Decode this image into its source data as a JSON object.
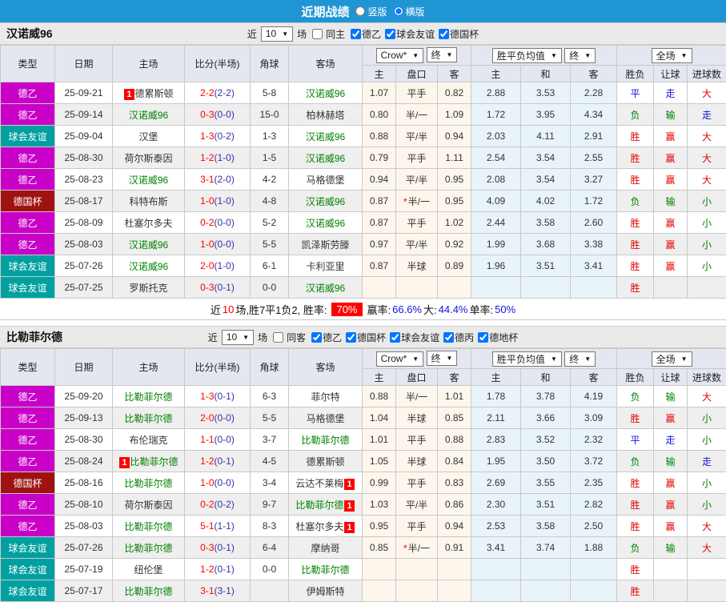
{
  "colors": {
    "accent_blue": "#2095d3",
    "league_de2": "#c800c8",
    "league_cup": "#a01212",
    "league_friendly": "#00a0a0",
    "self_team_green": "#008000",
    "fulltime_score_red": "#ff0000",
    "halftime_score_navy": "#3434a6",
    "win_red": "#e60000",
    "lose_green": "#008000",
    "draw_blue": "#1414dc",
    "rate_badge_bg": "#ff0000"
  },
  "titlebar": {
    "title": "近期战绩",
    "radios": [
      {
        "label": "竖版",
        "checked": false
      },
      {
        "label": "横版",
        "checked": true
      }
    ]
  },
  "header": {
    "cols": [
      "类型",
      "日期",
      "主场",
      "比分(半场)",
      "角球",
      "客场"
    ],
    "dropdowns": {
      "odds": "Crow*",
      "end1": "终",
      "avg": "胜平负均值",
      "end2": "终",
      "full": "全场"
    },
    "subcols": [
      "主",
      "盘口",
      "客",
      "主",
      "和",
      "客",
      "胜负",
      "让球",
      "进球数"
    ]
  },
  "sections": [
    {
      "team": "汉诺威96",
      "near_label": "近",
      "count": "10",
      "unit_label": "场",
      "same_filter": {
        "label": "同主",
        "checked": false
      },
      "filters": [
        {
          "label": "德乙",
          "checked": true
        },
        {
          "label": "球会友谊",
          "checked": true
        },
        {
          "label": "德国杯",
          "checked": true
        }
      ],
      "rows": [
        {
          "lg": "德乙",
          "lgc": "de2",
          "date": "25-09-21",
          "h": "德累斯顿",
          "hs": false,
          "hb": "pre",
          "ft": "2-2",
          "ht": "(2-2)",
          "cn": "5-8",
          "a": "汉诺威96",
          "as": true,
          "ab": null,
          "o1": "1.07",
          "o2": "平手",
          "star": false,
          "o3": "0.82",
          "a1": "2.88",
          "a2": "3.53",
          "a3": "2.28",
          "r1": "平",
          "c1": "b",
          "r2": "走",
          "c2": "b",
          "r3": "大",
          "c3": "r"
        },
        {
          "lg": "德乙",
          "lgc": "de2",
          "date": "25-09-14",
          "h": "汉诺威96",
          "hs": true,
          "hb": null,
          "ft": "0-3",
          "ht": "(0-0)",
          "cn": "15-0",
          "a": "柏林赫塔",
          "as": false,
          "ab": null,
          "o1": "0.80",
          "o2": "半/一",
          "star": false,
          "o3": "1.09",
          "a1": "1.72",
          "a2": "3.95",
          "a3": "4.34",
          "r1": "负",
          "c1": "g",
          "r2": "输",
          "c2": "g",
          "r3": "走",
          "c3": "b"
        },
        {
          "lg": "球会友谊",
          "lgc": "frd",
          "date": "25-09-04",
          "h": "汉堡",
          "hs": false,
          "hb": null,
          "ft": "1-3",
          "ht": "(0-2)",
          "cn": "1-3",
          "a": "汉诺威96",
          "as": true,
          "ab": null,
          "o1": "0.88",
          "o2": "平/半",
          "star": false,
          "o3": "0.94",
          "a1": "2.03",
          "a2": "4.11",
          "a3": "2.91",
          "r1": "胜",
          "c1": "r",
          "r2": "赢",
          "c2": "r",
          "r3": "大",
          "c3": "r"
        },
        {
          "lg": "德乙",
          "lgc": "de2",
          "date": "25-08-30",
          "h": "荷尔斯泰因",
          "hs": false,
          "hb": null,
          "ft": "1-2",
          "ht": "(1-0)",
          "cn": "1-5",
          "a": "汉诺威96",
          "as": true,
          "ab": null,
          "o1": "0.79",
          "o2": "平手",
          "star": false,
          "o3": "1.11",
          "a1": "2.54",
          "a2": "3.54",
          "a3": "2.55",
          "r1": "胜",
          "c1": "r",
          "r2": "赢",
          "c2": "r",
          "r3": "大",
          "c3": "r"
        },
        {
          "lg": "德乙",
          "lgc": "de2",
          "date": "25-08-23",
          "h": "汉诺威96",
          "hs": true,
          "hb": null,
          "ft": "3-1",
          "ht": "(2-0)",
          "cn": "4-2",
          "a": "马格德堡",
          "as": false,
          "ab": null,
          "o1": "0.94",
          "o2": "平/半",
          "star": false,
          "o3": "0.95",
          "a1": "2.08",
          "a2": "3.54",
          "a3": "3.27",
          "r1": "胜",
          "c1": "r",
          "r2": "赢",
          "c2": "r",
          "r3": "大",
          "c3": "r"
        },
        {
          "lg": "德国杯",
          "lgc": "cup",
          "date": "25-08-17",
          "h": "科特布斯",
          "hs": false,
          "hb": null,
          "ft": "1-0",
          "ht": "(1-0)",
          "cn": "4-8",
          "a": "汉诺威96",
          "as": true,
          "ab": null,
          "o1": "0.87",
          "o2": "半/一",
          "star": true,
          "o3": "0.95",
          "a1": "4.09",
          "a2": "4.02",
          "a3": "1.72",
          "r1": "负",
          "c1": "g",
          "r2": "输",
          "c2": "g",
          "r3": "小",
          "c3": "g"
        },
        {
          "lg": "德乙",
          "lgc": "de2",
          "date": "25-08-09",
          "h": "杜塞尔多夫",
          "hs": false,
          "hb": null,
          "ft": "0-2",
          "ht": "(0-0)",
          "cn": "5-2",
          "a": "汉诺威96",
          "as": true,
          "ab": null,
          "o1": "0.87",
          "o2": "平手",
          "star": false,
          "o3": "1.02",
          "a1": "2.44",
          "a2": "3.58",
          "a3": "2.60",
          "r1": "胜",
          "c1": "r",
          "r2": "赢",
          "c2": "r",
          "r3": "小",
          "c3": "g"
        },
        {
          "lg": "德乙",
          "lgc": "de2",
          "date": "25-08-03",
          "h": "汉诺威96",
          "hs": true,
          "hb": null,
          "ft": "1-0",
          "ht": "(0-0)",
          "cn": "5-5",
          "a": "凯泽斯劳滕",
          "as": false,
          "ab": null,
          "o1": "0.97",
          "o2": "平/半",
          "star": false,
          "o3": "0.92",
          "a1": "1.99",
          "a2": "3.68",
          "a3": "3.38",
          "r1": "胜",
          "c1": "r",
          "r2": "赢",
          "c2": "r",
          "r3": "小",
          "c3": "g"
        },
        {
          "lg": "球会友谊",
          "lgc": "frd",
          "date": "25-07-26",
          "h": "汉诺威96",
          "hs": true,
          "hb": null,
          "ft": "2-0",
          "ht": "(1-0)",
          "cn": "6-1",
          "a": "卡利亚里",
          "as": false,
          "ab": null,
          "o1": "0.87",
          "o2": "半球",
          "star": false,
          "o3": "0.89",
          "a1": "1.96",
          "a2": "3.51",
          "a3": "3.41",
          "r1": "胜",
          "c1": "r",
          "r2": "赢",
          "c2": "r",
          "r3": "小",
          "c3": "g"
        },
        {
          "lg": "球会友谊",
          "lgc": "frd",
          "date": "25-07-25",
          "h": "罗斯托克",
          "hs": false,
          "hb": null,
          "ft": "0-3",
          "ht": "(0-1)",
          "cn": "0-0",
          "a": "汉诺威96",
          "as": true,
          "ab": null,
          "o1": "",
          "o2": "",
          "star": false,
          "o3": "",
          "a1": "",
          "a2": "",
          "a3": "",
          "r1": "胜",
          "c1": "r",
          "r2": "",
          "c2": "",
          "r3": "",
          "c3": ""
        }
      ],
      "summary": {
        "prefix": "近",
        "count": "10",
        "mid": "场,胜7平1负2, 胜率:",
        "rate": "70%",
        "win_label": "赢率:",
        "win": "66.6%",
        "big_label": "大:",
        "big": "44.4%",
        "single_label": "单率:",
        "single": "50%"
      }
    },
    {
      "team": "比勒菲尔德",
      "near_label": "近",
      "count": "10",
      "unit_label": "场",
      "same_filter": {
        "label": "同客",
        "checked": false
      },
      "filters": [
        {
          "label": "德乙",
          "checked": true
        },
        {
          "label": "德国杯",
          "checked": true
        },
        {
          "label": "球会友谊",
          "checked": true
        },
        {
          "label": "德丙",
          "checked": true
        },
        {
          "label": "德地杯",
          "checked": true
        }
      ],
      "rows": [
        {
          "lg": "德乙",
          "lgc": "de2",
          "date": "25-09-20",
          "h": "比勒菲尔德",
          "hs": true,
          "hb": null,
          "ft": "1-3",
          "ht": "(0-1)",
          "cn": "6-3",
          "a": "菲尔特",
          "as": false,
          "ab": null,
          "o1": "0.88",
          "o2": "半/一",
          "star": false,
          "o3": "1.01",
          "a1": "1.78",
          "a2": "3.78",
          "a3": "4.19",
          "r1": "负",
          "c1": "g",
          "r2": "输",
          "c2": "g",
          "r3": "大",
          "c3": "r"
        },
        {
          "lg": "德乙",
          "lgc": "de2",
          "date": "25-09-13",
          "h": "比勒菲尔德",
          "hs": true,
          "hb": null,
          "ft": "2-0",
          "ht": "(0-0)",
          "cn": "5-5",
          "a": "马格德堡",
          "as": false,
          "ab": null,
          "o1": "1.04",
          "o2": "半球",
          "star": false,
          "o3": "0.85",
          "a1": "2.11",
          "a2": "3.66",
          "a3": "3.09",
          "r1": "胜",
          "c1": "r",
          "r2": "赢",
          "c2": "r",
          "r3": "小",
          "c3": "g"
        },
        {
          "lg": "德乙",
          "lgc": "de2",
          "date": "25-08-30",
          "h": "布伦瑞克",
          "hs": false,
          "hb": null,
          "ft": "1-1",
          "ht": "(0-0)",
          "cn": "3-7",
          "a": "比勒菲尔德",
          "as": true,
          "ab": null,
          "o1": "1.01",
          "o2": "平手",
          "star": false,
          "o3": "0.88",
          "a1": "2.83",
          "a2": "3.52",
          "a3": "2.32",
          "r1": "平",
          "c1": "b",
          "r2": "走",
          "c2": "b",
          "r3": "小",
          "c3": "g"
        },
        {
          "lg": "德乙",
          "lgc": "de2",
          "date": "25-08-24",
          "h": "比勒菲尔德",
          "hs": true,
          "hb": "pre",
          "ft": "1-2",
          "ht": "(0-1)",
          "cn": "4-5",
          "a": "德累斯顿",
          "as": false,
          "ab": null,
          "o1": "1.05",
          "o2": "半球",
          "star": false,
          "o3": "0.84",
          "a1": "1.95",
          "a2": "3.50",
          "a3": "3.72",
          "r1": "负",
          "c1": "g",
          "r2": "输",
          "c2": "g",
          "r3": "走",
          "c3": "b"
        },
        {
          "lg": "德国杯",
          "lgc": "cup",
          "date": "25-08-16",
          "h": "比勒菲尔德",
          "hs": true,
          "hb": null,
          "ft": "1-0",
          "ht": "(0-0)",
          "cn": "3-4",
          "a": "云达不莱梅",
          "as": false,
          "ab": "post",
          "o1": "0.99",
          "o2": "平手",
          "star": false,
          "o3": "0.83",
          "a1": "2.69",
          "a2": "3.55",
          "a3": "2.35",
          "r1": "胜",
          "c1": "r",
          "r2": "赢",
          "c2": "r",
          "r3": "小",
          "c3": "g"
        },
        {
          "lg": "德乙",
          "lgc": "de2",
          "date": "25-08-10",
          "h": "荷尔斯泰因",
          "hs": false,
          "hb": null,
          "ft": "0-2",
          "ht": "(0-2)",
          "cn": "9-7",
          "a": "比勒菲尔德",
          "as": true,
          "ab": "post",
          "o1": "1.03",
          "o2": "平/半",
          "star": false,
          "o3": "0.86",
          "a1": "2.30",
          "a2": "3.51",
          "a3": "2.82",
          "r1": "胜",
          "c1": "r",
          "r2": "赢",
          "c2": "r",
          "r3": "小",
          "c3": "g"
        },
        {
          "lg": "德乙",
          "lgc": "de2",
          "date": "25-08-03",
          "h": "比勒菲尔德",
          "hs": true,
          "hb": null,
          "ft": "5-1",
          "ht": "(1-1)",
          "cn": "8-3",
          "a": "杜塞尔多夫",
          "as": false,
          "ab": "post",
          "o1": "0.95",
          "o2": "平手",
          "star": false,
          "o3": "0.94",
          "a1": "2.53",
          "a2": "3.58",
          "a3": "2.50",
          "r1": "胜",
          "c1": "r",
          "r2": "赢",
          "c2": "r",
          "r3": "大",
          "c3": "r"
        },
        {
          "lg": "球会友谊",
          "lgc": "frd",
          "date": "25-07-26",
          "h": "比勒菲尔德",
          "hs": true,
          "hb": null,
          "ft": "0-3",
          "ht": "(0-1)",
          "cn": "6-4",
          "a": "摩纳哥",
          "as": false,
          "ab": null,
          "o1": "0.85",
          "o2": "半/一",
          "star": true,
          "o3": "0.91",
          "a1": "3.41",
          "a2": "3.74",
          "a3": "1.88",
          "r1": "负",
          "c1": "g",
          "r2": "输",
          "c2": "g",
          "r3": "大",
          "c3": "r"
        },
        {
          "lg": "球会友谊",
          "lgc": "frd",
          "date": "25-07-19",
          "h": "纽伦堡",
          "hs": false,
          "hb": null,
          "ft": "1-2",
          "ht": "(0-1)",
          "cn": "0-0",
          "a": "比勒菲尔德",
          "as": true,
          "ab": null,
          "o1": "",
          "o2": "",
          "star": false,
          "o3": "",
          "a1": "",
          "a2": "",
          "a3": "",
          "r1": "胜",
          "c1": "r",
          "r2": "",
          "c2": "",
          "r3": "",
          "c3": ""
        },
        {
          "lg": "球会友谊",
          "lgc": "frd",
          "date": "25-07-17",
          "h": "比勒菲尔德",
          "hs": true,
          "hb": null,
          "ft": "3-1",
          "ht": "(3-1)",
          "cn": "",
          "a": "伊姆斯特",
          "as": false,
          "ab": null,
          "o1": "",
          "o2": "",
          "star": false,
          "o3": "",
          "a1": "",
          "a2": "",
          "a3": "",
          "r1": "胜",
          "c1": "r",
          "r2": "",
          "c2": "",
          "r3": "",
          "c3": ""
        }
      ],
      "summary": null
    }
  ]
}
